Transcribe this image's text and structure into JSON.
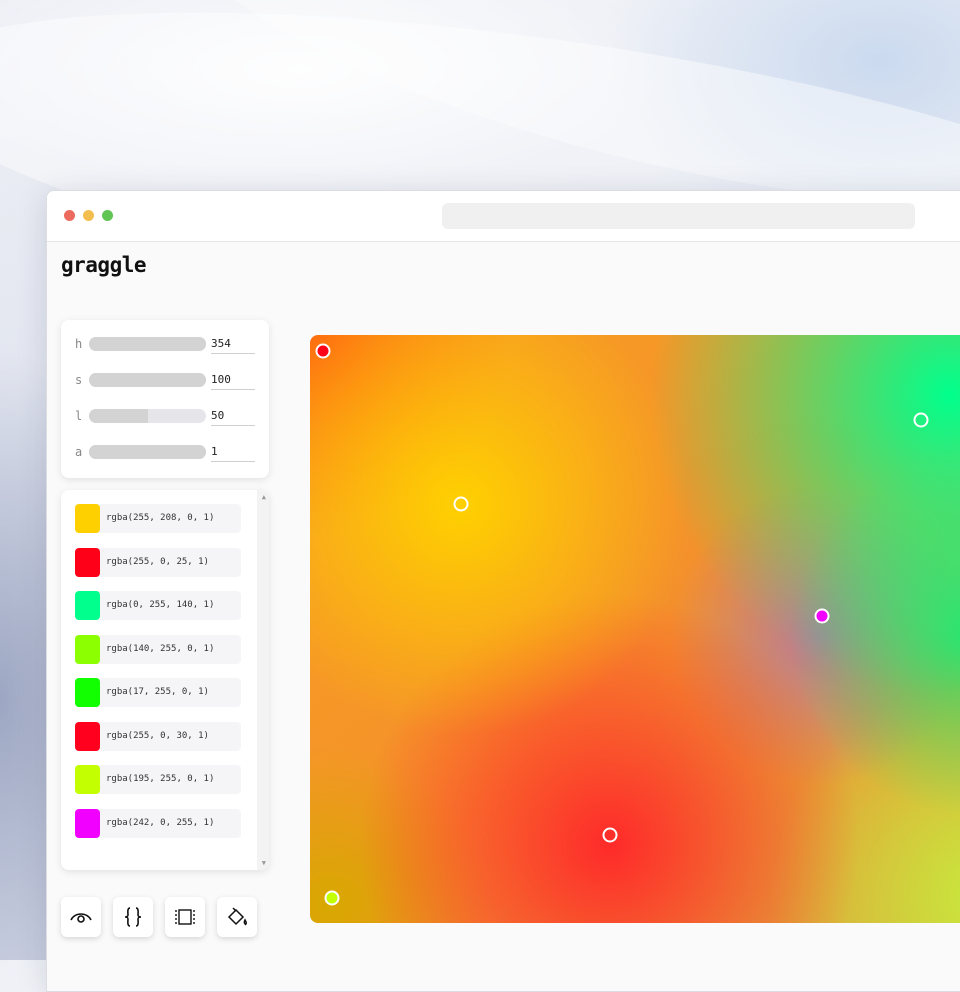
{
  "app": {
    "title": "graggle"
  },
  "hsla": [
    {
      "label": "h",
      "value": "354",
      "fill_fraction": 1.0
    },
    {
      "label": "s",
      "value": "100",
      "fill_fraction": 1.0
    },
    {
      "label": "l",
      "value": "50",
      "fill_fraction": 0.5
    },
    {
      "label": "a",
      "value": "1",
      "fill_fraction": 1.0
    }
  ],
  "colors": [
    {
      "rgba": "rgba(255, 208, 0, 1)",
      "hex": "#ffd000"
    },
    {
      "rgba": "rgba(255, 0, 25, 1)",
      "hex": "#ff0019"
    },
    {
      "rgba": "rgba(0, 255, 140, 1)",
      "hex": "#00ff8c"
    },
    {
      "rgba": "rgba(140, 255, 0, 1)",
      "hex": "#8cff00"
    },
    {
      "rgba": "rgba(17, 255, 0, 1)",
      "hex": "#11ff00"
    },
    {
      "rgba": "rgba(255, 0, 30, 1)",
      "hex": "#ff001e"
    },
    {
      "rgba": "rgba(195, 255, 0, 1)",
      "hex": "#c3ff00"
    },
    {
      "rgba": "rgba(242, 0, 255, 1)",
      "hex": "#f200ff"
    }
  ],
  "toolbar": [
    {
      "name": "eye-icon"
    },
    {
      "name": "braces-icon"
    },
    {
      "name": "frame-icon"
    },
    {
      "name": "paint-bucket-icon"
    }
  ],
  "handles": [
    {
      "color": "#ff0019",
      "filled": true
    },
    {
      "color": "#ffd000",
      "filled": false
    },
    {
      "color": "#00ff8c",
      "filled": false
    },
    {
      "color": "#f200ff",
      "filled": true
    },
    {
      "color": "#ff001e",
      "filled": false
    },
    {
      "color": "#c3ff00",
      "filled": true
    }
  ]
}
